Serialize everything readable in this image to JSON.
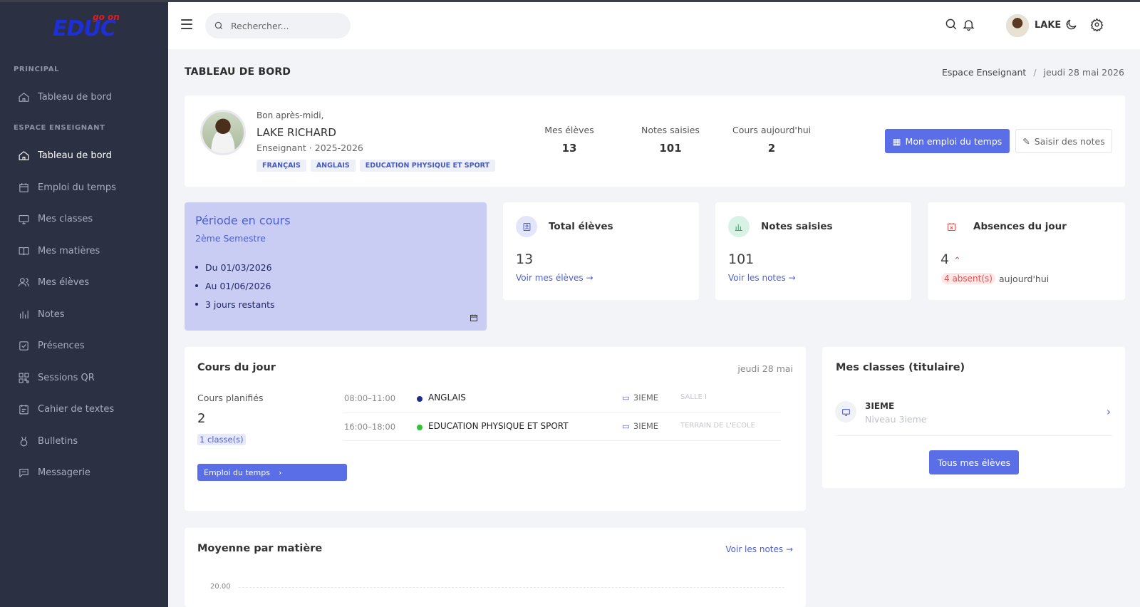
{
  "app": {
    "logo_small": "go on",
    "logo_brand": "EDUC"
  },
  "sidebar": {
    "section_principal": "PRINCIPAL",
    "principal_items": [
      {
        "label": "Tableau de bord",
        "icon": "home-icon"
      }
    ],
    "section_enseignant": "ESPACE ENSEIGNANT",
    "items": [
      {
        "label": "Tableau de bord",
        "icon": "home-icon",
        "active": true
      },
      {
        "label": "Emploi du temps",
        "icon": "calendar-icon"
      },
      {
        "label": "Mes classes",
        "icon": "monitor-icon"
      },
      {
        "label": "Mes matières",
        "icon": "book-icon"
      },
      {
        "label": "Mes élèves",
        "icon": "users-icon"
      },
      {
        "label": "Notes",
        "icon": "bar-chart-icon"
      },
      {
        "label": "Présences",
        "icon": "check-square-icon"
      },
      {
        "label": "Sessions QR",
        "icon": "qr-code-icon"
      },
      {
        "label": "Cahier de textes",
        "icon": "notebook-icon"
      },
      {
        "label": "Bulletins",
        "icon": "medal-icon"
      },
      {
        "label": "Messagerie",
        "icon": "message-icon"
      }
    ]
  },
  "header": {
    "search_placeholder": "Rechercher...",
    "user_name": "LAKE"
  },
  "page": {
    "title": "TABLEAU DE BORD",
    "breadcrumb_section": "Espace Enseignant",
    "breadcrumb_date": "jeudi 28 mai 2026"
  },
  "profile": {
    "greeting": "Bon après-midi,",
    "name": "LAKE RICHARD",
    "role": "Enseignant · 2025-2026",
    "tags": [
      "FRANÇAIS",
      "ANGLAIS",
      "EDUCATION PHYSIQUE ET SPORT"
    ],
    "stats": [
      {
        "label": "Mes élèves",
        "value": "13"
      },
      {
        "label": "Notes saisies",
        "value": "101"
      },
      {
        "label": "Cours aujourd'hui",
        "value": "2"
      }
    ],
    "btn_schedule": "Mon emploi du temps",
    "btn_grades": "Saisir des notes"
  },
  "period": {
    "title": "Période en cours",
    "subtitle": "2ème Semestre",
    "items": [
      "Du 01/03/2026",
      "Au 01/06/2026",
      "3 jours restants"
    ]
  },
  "kpis": {
    "students": {
      "title": "Total élèves",
      "value": "13",
      "link": "Voir mes élèves →"
    },
    "grades": {
      "title": "Notes saisies",
      "value": "101",
      "link": "Voir les notes →"
    },
    "absences": {
      "title": "Absences du jour",
      "value": "4",
      "badge": "4 absent(s)",
      "suffix": "aujourd'hui"
    }
  },
  "today": {
    "title": "Cours du jour",
    "date": "jeudi 28 mai",
    "planned_label": "Cours planifiés",
    "planned_value": "2",
    "classes_badge": "1 classe(s)",
    "btn_schedule": "Emploi du temps",
    "courses": [
      {
        "time": "08:00–11:00",
        "subject": "ANGLAIS",
        "color": "#1e2f8a",
        "class": "3IEME",
        "room": "SALLE I"
      },
      {
        "time": "16:00–18:00",
        "subject": "EDUCATION PHYSIQUE ET SPORT",
        "color": "#2fc42f",
        "class": "3IEME",
        "room": "TERRAIN DE L'ECOLE"
      }
    ]
  },
  "my_classes": {
    "title": "Mes classes (titulaire)",
    "class_name": "3IEME",
    "class_level": "Niveau 3ieme",
    "btn_all": "Tous mes élèves"
  },
  "averages": {
    "title": "Moyenne par matière",
    "link": "Voir les notes →",
    "y_tick": "20.00"
  },
  "colors": {
    "accent": "#5a6ee8",
    "sidebar": "#2b3042",
    "period_bg": "#c9cdf3",
    "danger": "#e05252"
  }
}
